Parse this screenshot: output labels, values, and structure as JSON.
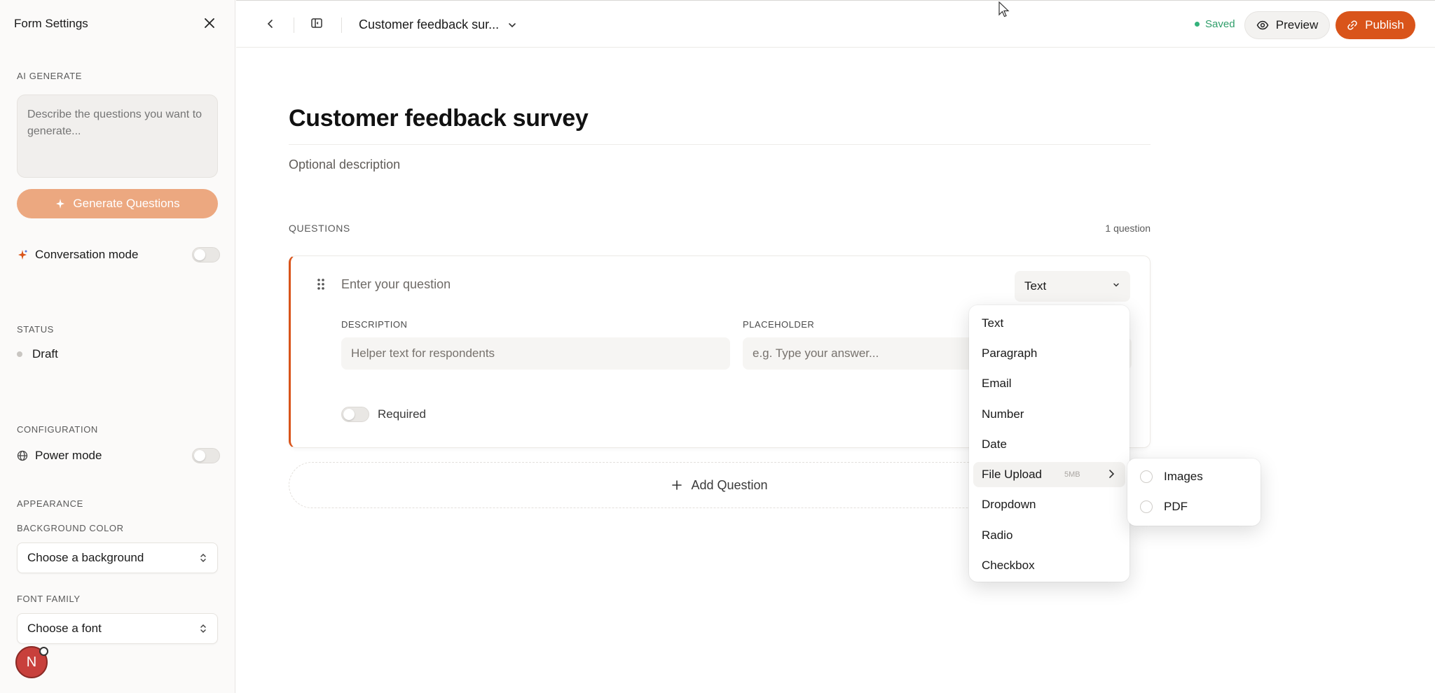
{
  "sidebar": {
    "title": "Form Settings",
    "ai_section": "AI GENERATE",
    "ai_placeholder": "Describe the questions you want to generate...",
    "generate_label": "Generate Questions",
    "conversation_label": "Conversation mode",
    "status_section": "STATUS",
    "status_value": "Draft",
    "config_section": "CONFIGURATION",
    "power_label": "Power mode",
    "appearance_section": "APPEARANCE",
    "bg_section": "BACKGROUND COLOR",
    "bg_placeholder": "Choose a background",
    "font_section": "FONT FAMILY",
    "font_placeholder": "Choose a font",
    "avatar_initial": "N"
  },
  "topbar": {
    "form_name": "Customer feedback sur...",
    "saved": "Saved",
    "preview": "Preview",
    "publish": "Publish"
  },
  "main": {
    "title": "Customer feedback survey",
    "description": "Optional description",
    "questions_header": "QUESTIONS",
    "question_count": "1 question",
    "question": {
      "placeholder": "Enter your question",
      "type": "Text",
      "description_label": "DESCRIPTION",
      "description_placeholder": "Helper text for respondents",
      "placeholder_label": "PLACEHOLDER",
      "placeholder_placeholder": "e.g. Type your answer...",
      "required_label": "Required"
    },
    "add_question": "Add Question"
  },
  "type_menu": {
    "items": [
      "Text",
      "Paragraph",
      "Email",
      "Number",
      "Date",
      "File Upload",
      "Dropdown",
      "Radio",
      "Checkbox"
    ],
    "file_upload_meta": "5MB",
    "submenu": [
      "Images",
      "PDF"
    ]
  },
  "colors": {
    "accent": "#d9541a",
    "generate_button": "#eca880",
    "saved_green": "#2f9e6a"
  }
}
